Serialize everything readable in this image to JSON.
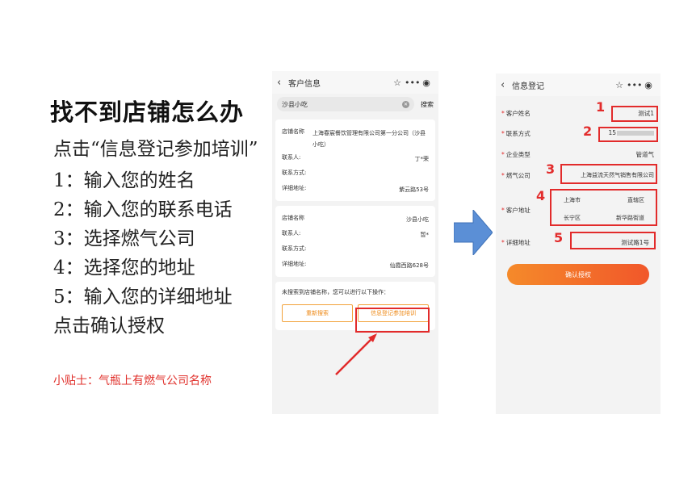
{
  "slide": {
    "title": "找不到店铺怎么办",
    "intro": "点击“信息登记参加培训”",
    "steps": [
      "1：输入您的姓名",
      "2：输入您的联系电话",
      "3：选择燃气公司",
      "4：选择您的地址",
      "5：输入您的详细地址"
    ],
    "confirm_step": "点击确认授权",
    "tip": "小贴士：气瓶上有燃气公司名称"
  },
  "search_screen": {
    "nav_title": "客户信息",
    "search_value": "沙县小吃",
    "search_button": "搜索",
    "results": [
      {
        "name_label": "店铺名称",
        "name": "上海春宸餐饮管理有限公司第一分公司（沙县小吃）",
        "contact_label": "联系人:",
        "contact": "丁*荣",
        "phone_label": "联系方式:",
        "phone": "",
        "address_label": "详细地址:",
        "address": "紫云路53号"
      },
      {
        "name_label": "店铺名称",
        "name": "沙县小吃",
        "contact_label": "联系人:",
        "contact": "暂*",
        "phone_label": "联系方式:",
        "phone": "",
        "address_label": "详细地址:",
        "address": "仙霞西路628号"
      }
    ],
    "not_found_message": "未搜索到店铺名称，您可以进行以下操作：",
    "research_button": "重新搜索",
    "register_button": "信息登记参加培训"
  },
  "register_screen": {
    "nav_title": "信息登记",
    "fields": {
      "name_label": "客户姓名",
      "name_value": "测试1",
      "phone_label": "联系方式",
      "phone_value": "15",
      "type_label": "企业类型",
      "type_value": "管道气",
      "gas_label": "燃气公司",
      "gas_value": "上海益流天然气销售有限公司",
      "address_label": "客户地址",
      "city": "上海市",
      "district_level": "直辖区",
      "district": "长宁区",
      "street": "新华路街道",
      "detail_label": "详细地址",
      "detail_value": "测试路1号"
    },
    "confirm_button": "确认授权",
    "callouts": [
      "1",
      "2",
      "3",
      "4",
      "5"
    ]
  },
  "colors": {
    "highlight": "#e22b2b",
    "accent_orange": "#f1572a",
    "arrow_blue": "#5b8fd6"
  },
  "icons": {
    "back": "chevron-left-icon",
    "star": "star-icon",
    "more": "more-icon",
    "target": "record-icon",
    "clear": "clear-icon",
    "arrow": "right-arrow-icon"
  }
}
